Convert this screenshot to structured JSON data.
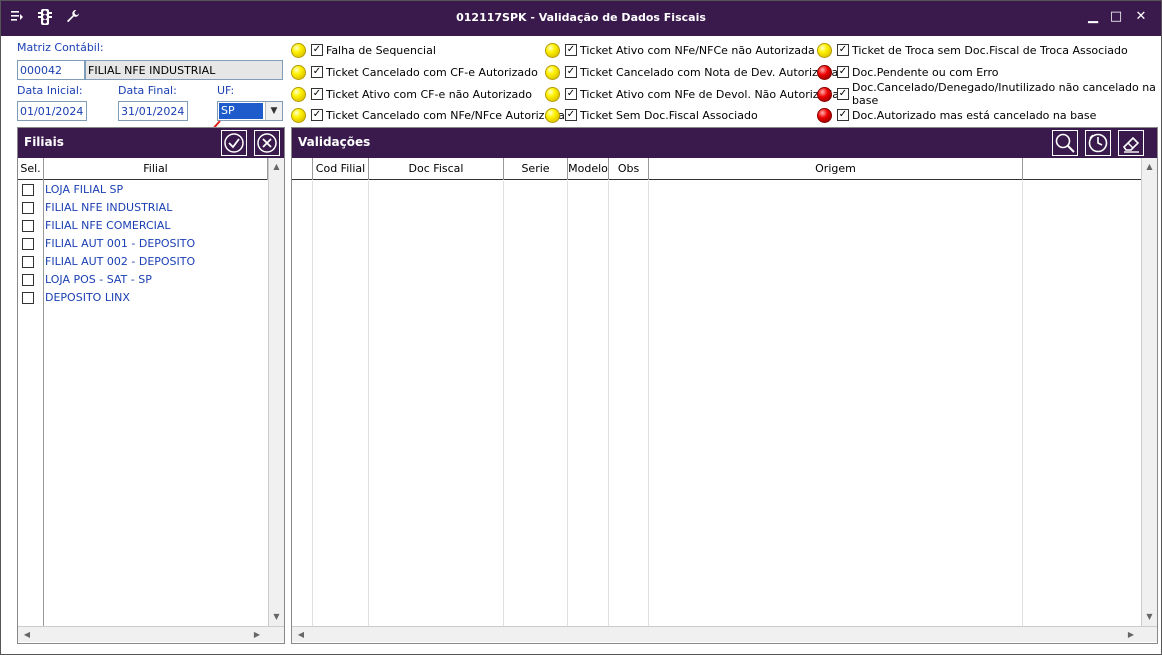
{
  "window": {
    "title": "012117SPK - Validação de Dados Fiscais",
    "minimize": "▁",
    "maximize": "□",
    "close": "✕"
  },
  "form": {
    "matriz_label": "Matriz Contábil:",
    "matriz_code": "000042",
    "matriz_name": "FILIAL NFE INDUSTRIAL",
    "data_inicial_label": "Data Inicial:",
    "data_inicial": "01/01/2024",
    "data_final_label": "Data Final:",
    "data_final": "31/01/2024",
    "uf_label": "UF:",
    "uf_value": "SP"
  },
  "legend": [
    {
      "color": "yellow",
      "label": "Falha de Sequencial"
    },
    {
      "color": "yellow",
      "label": "Ticket Cancelado com CF-e Autorizado"
    },
    {
      "color": "yellow",
      "label": "Ticket Ativo com CF-e não Autorizado"
    },
    {
      "color": "yellow",
      "label": "Ticket Cancelado com NFe/NFce Autorizada"
    },
    {
      "color": "yellow",
      "label": "Ticket Ativo com NFe/NFCe não Autorizada"
    },
    {
      "color": "yellow",
      "label": "Ticket Cancelado com Nota de Dev. Autorizada"
    },
    {
      "color": "yellow",
      "label": "Ticket Ativo com NFe de Devol. Não Autorizada"
    },
    {
      "color": "yellow",
      "label": "Ticket Sem Doc.Fiscal Associado"
    },
    {
      "color": "yellow",
      "label": "Ticket de Troca sem Doc.Fiscal de Troca Associado"
    },
    {
      "color": "red",
      "label": "Doc.Pendente ou com Erro"
    },
    {
      "color": "red",
      "label": "Doc.Cancelado/Denegado/Inutilizado não cancelado na base"
    },
    {
      "color": "red",
      "label": "Doc.Autorizado mas está cancelado na base"
    }
  ],
  "filiais": {
    "title": "Filiais",
    "col_sel": "Sel.",
    "col_filial": "Filial",
    "items": [
      "LOJA FILIAL SP",
      "FILIAL NFE INDUSTRIAL",
      "FILIAL NFE COMERCIAL",
      "FILIAL AUT 001 - DEPOSITO",
      "FILIAL AUT 002 - DEPOSITO",
      "LOJA POS - SAT - SP",
      "DEPOSITO LINX"
    ]
  },
  "validacoes": {
    "title": "Validações",
    "columns": [
      "Cod Filial",
      "Doc Fiscal",
      "Serie",
      "Modelo",
      "Obs",
      "Origem"
    ]
  },
  "colors": {
    "header_bg": "#3a1a4d",
    "link_blue": "#1a3fb3",
    "annotation_arrow": "#e02020"
  }
}
